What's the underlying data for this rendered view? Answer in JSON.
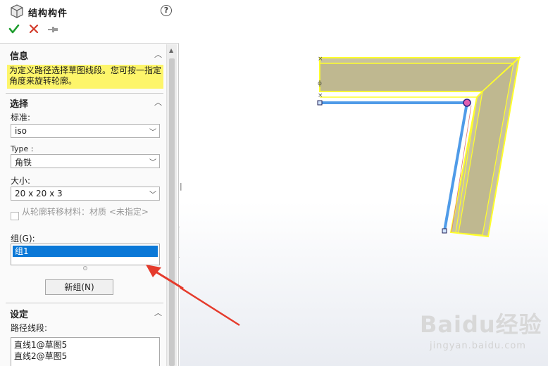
{
  "header": {
    "title": "结构构件",
    "help_glyph": "?"
  },
  "info": {
    "title": "信息",
    "message": "为定义路径选择草图线段。您可按一指定角度来旋转轮廓。"
  },
  "selection": {
    "title": "选择",
    "standard_label": "标准:",
    "standard_value": "iso",
    "type_label": "Type :",
    "type_value": "角铁",
    "size_label": "大小:",
    "size_value": "20 x 20 x 3",
    "transfer_material_label": "从轮廓转移材料：材质 <未指定>",
    "group_label": "组(G):",
    "groups": [
      "组1"
    ],
    "new_group_button": "新组(N)"
  },
  "settings": {
    "title": "设定",
    "path_segments_label": "路径线段:",
    "path_segments": [
      "直线1@草图5",
      "直线2@草图5"
    ]
  },
  "watermark": {
    "logo": "Baidu经验",
    "url": "jingyan.baidu.com"
  },
  "colors": {
    "accent_blue": "#0a78d7",
    "info_yellow": "#fdf56a",
    "profile_yellow": "#ffff2a",
    "profile_fill": "#c8c2a0",
    "path_blue": "#4f9be8",
    "arrow_red": "#e53b2c"
  },
  "icons": {
    "cube": "cube-icon",
    "ok": "checkmark-icon",
    "cancel": "close-icon",
    "pin": "pushpin-icon",
    "help": "help-icon"
  }
}
